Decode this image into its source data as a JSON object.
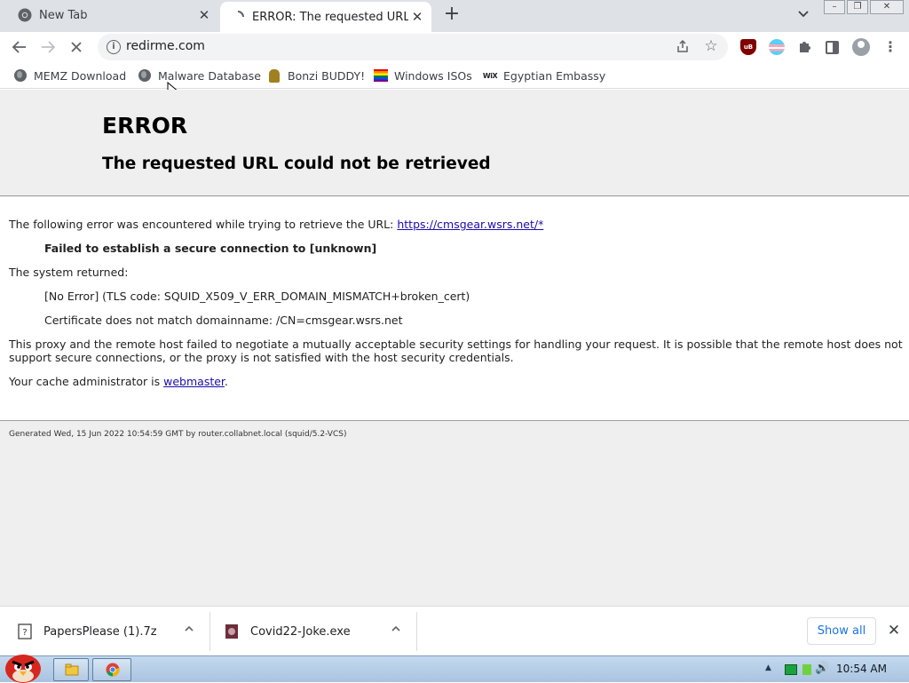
{
  "tabs": [
    {
      "title": "New Tab",
      "active": false,
      "icon": "chrome-icon"
    },
    {
      "title": "ERROR: The requested URL could not be retrieved",
      "active": true,
      "icon": "loading-icon"
    }
  ],
  "toolbar": {
    "url": "redirme.com",
    "new_tab_symbol": "+",
    "tab_search_symbol": "⌄"
  },
  "bookmarks": [
    {
      "label": "MEMZ Download",
      "icon": "globe-icon"
    },
    {
      "label": "Malware Database",
      "icon": "globe-icon"
    },
    {
      "label": "Bonzi BUDDY!",
      "icon": "bonzi-icon"
    },
    {
      "label": "Windows ISOs",
      "icon": "rainbow-flag-icon"
    },
    {
      "label": "Egyptian Embassy",
      "icon": "wix-icon"
    }
  ],
  "page": {
    "title": "ERROR",
    "subtitle": "The requested URL could not be retrieved",
    "intro": "The following error was encountered while trying to retrieve the URL:",
    "intro_link": "https://cmsgear.wsrs.net/*",
    "error_bold": "Failed to establish a secure connection to [unknown]",
    "system_returned": "The system returned:",
    "tls_code": "[No Error] (TLS code: SQUID_X509_V_ERR_DOMAIN_MISMATCH+broken_cert)",
    "cert_mismatch": "Certificate does not match domainname: /CN=cmsgear.wsrs.net",
    "explanation_1": "This proxy and the remote host failed to negotiate a mutually acceptable security settings for handling your request. It is possible that the remote host does not",
    "explanation_2": "support secure connections, or the proxy is not satisfied with the host security credentials.",
    "admin_prefix": "Your cache administrator is",
    "admin_link": "webmaster",
    "admin_suffix": ".",
    "footer": "Generated Wed, 15 Jun 2022 10:54:59 GMT by router.collabnet.local (squid/5.2-VCS)"
  },
  "downloads": {
    "items": [
      {
        "name": "PapersPlease (1).7z",
        "icon": "archive-icon"
      },
      {
        "name": "Covid22-Joke.exe",
        "icon": "exe-icon"
      }
    ],
    "show_all": "Show all",
    "close_symbol": "✕"
  },
  "taskbar": {
    "clock": "10:54 AM"
  },
  "colors": {
    "link": "#1a0dab",
    "accent": "#1a73e8",
    "page_bg": "#efefef"
  }
}
